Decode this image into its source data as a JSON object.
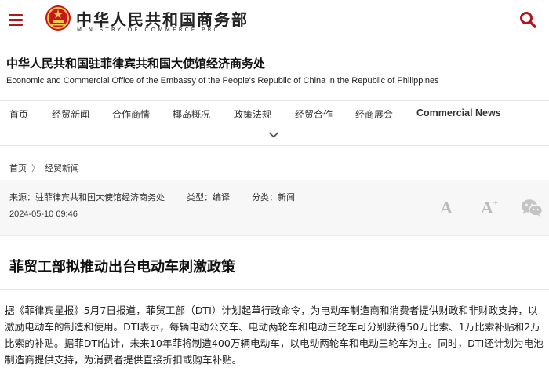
{
  "header": {
    "ministry_cn": "中华人民共和国商务部",
    "ministry_en": "MINISTRY OF COMMERCE.PRC",
    "menu_icon": "menu-icon",
    "search_icon": "search-icon",
    "accent_color": "#b4161b"
  },
  "office": {
    "name_cn": "中华人民共和国驻菲律宾共和国大使馆经济商务处",
    "name_en": "Economic and Commercial Office of the Embassy of the People's Republic of China in the Republic of Philippines"
  },
  "nav": {
    "items": [
      {
        "label": "首页"
      },
      {
        "label": "经贸新闻"
      },
      {
        "label": "合作商情"
      },
      {
        "label": "椰岛概况"
      },
      {
        "label": "政策法规"
      },
      {
        "label": "经贸合作"
      },
      {
        "label": "经商展会"
      },
      {
        "label": "Commercial News"
      }
    ],
    "expand_icon": "chevron-down-icon"
  },
  "breadcrumb": {
    "home": "首页",
    "separator": "〉",
    "current": "经贸新闻"
  },
  "meta": {
    "source": "来源：驻菲律宾共和国大使馆经济商务处",
    "type": "类型：编译",
    "category": "分类：新闻",
    "date": "2024-05-10 09:46",
    "font_smaller": "A",
    "font_larger": "A",
    "font_larger_sup": "+",
    "share_icon": "wechat-icon"
  },
  "article": {
    "title": "菲贸工部拟推动出台电动车刺激政策",
    "body": "据《菲律宾星报》5月7日报道，菲贸工部（DTI）计划起草行政命令，为电动车制造商和消费者提供财政和非财政支持，以激励电动车的制造和使用。DTI表示，每辆电动公交车、电动两轮车和电动三轮车可分别获得50万比索、1万比索补贴和2万比索的补贴。据菲DTI估计，未来10年菲将制造400万辆电动车，以电动两轮车和电动三轮车为主。同时，DTI还计划为电池制造商提供支持，为消费者提供直接折扣或购车补贴。"
  }
}
